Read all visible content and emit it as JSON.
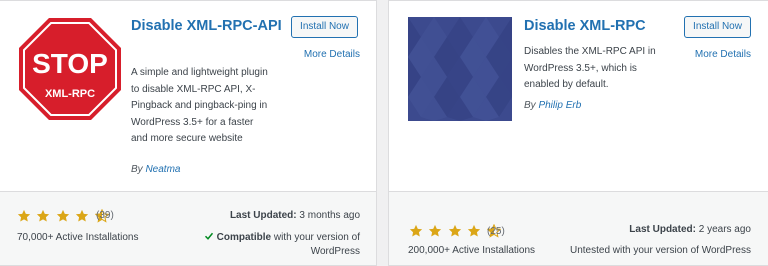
{
  "plugins": [
    {
      "thumbnail": {
        "sign_main_text": "STOP",
        "sign_sub_text": "XML-RPC",
        "bg_color": "#ffffff",
        "sign_color": "#d71e2b"
      },
      "title": "Disable XML-RPC-API",
      "description": "A simple and lightweight plugin to disable XML-RPC API, X-Pingback and pingback-ping in WordPress 3.5+ for a faster and more secure website",
      "author_prefix": "By ",
      "author": "Neatma",
      "install_label": "Install Now",
      "more_details_label": "More Details",
      "rating": 4.5,
      "rating_count": "(39)",
      "active_installs": "70,000+ Active Installations",
      "last_updated_label": "Last Updated:",
      "last_updated_value": " 3 months ago",
      "compat_label": "Compatible",
      "compat_text": " with your version of WordPress"
    },
    {
      "thumbnail": {
        "style": "blue-diamond-pattern",
        "color": "#3c4a8e"
      },
      "title": "Disable XML-RPC",
      "description": "Disables the XML-RPC API in WordPress 3.5+, which is enabled by default.",
      "author_prefix": "By ",
      "author": "Philip Erb",
      "install_label": "Install Now",
      "more_details_label": "More Details",
      "rating": 4.5,
      "rating_count": "(25)",
      "active_installs": "200,000+ Active Installations",
      "last_updated_label": "Last Updated:",
      "last_updated_value": " 2 years ago",
      "compat_text": "Untested with your version of WordPress"
    }
  ],
  "colors": {
    "link": "#2271b1",
    "star": "#dba617",
    "check": "#008a20"
  }
}
